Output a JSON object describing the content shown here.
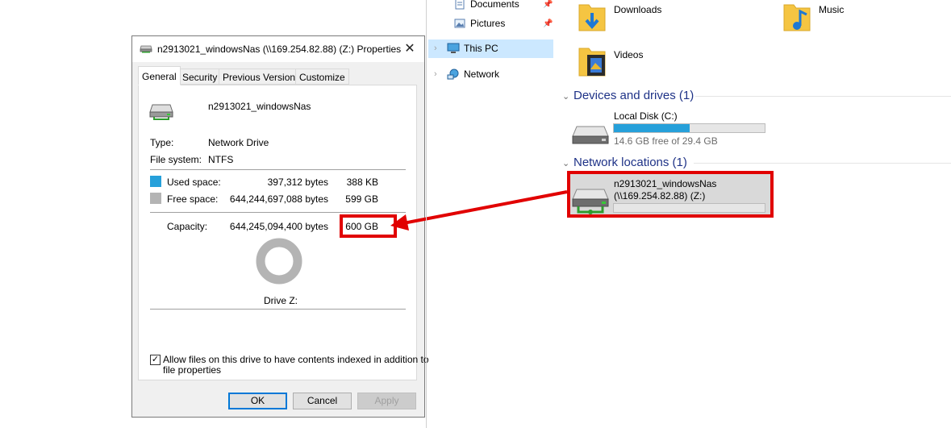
{
  "dialog": {
    "title": "n2913021_windowsNas (\\\\169.254.82.88) (Z:) Properties",
    "close_glyph": "✕",
    "tabs": [
      "General",
      "Security",
      "Previous Versions",
      "Customize"
    ],
    "active_tab": "General",
    "drive_name": "n2913021_windowsNas",
    "type_label": "Type:",
    "type_value": "Network Drive",
    "fs_label": "File system:",
    "fs_value": "NTFS",
    "used_label": "Used space:",
    "used_bytes": "397,312 bytes",
    "used_size": "388 KB",
    "free_label": "Free space:",
    "free_bytes": "644,244,697,088 bytes",
    "free_size": "599 GB",
    "capacity_label": "Capacity:",
    "capacity_bytes": "644,245,094,400 bytes",
    "capacity_size": "600 GB",
    "drive_caption": "Drive Z:",
    "used_fraction": 6e-07,
    "index_checked": true,
    "index_label_line1": "Allow files on this drive to have contents indexed in addition to",
    "index_label_line2": "file properties",
    "ok_label": "OK",
    "cancel_label": "Cancel",
    "apply_label": "Apply",
    "colors": {
      "used": "#26a0da",
      "free": "#b4b4b4",
      "highlight": "#e10000"
    }
  },
  "nav": {
    "quick_access": [
      {
        "label": "Documents",
        "icon": "documents-icon"
      },
      {
        "label": "Pictures",
        "icon": "pictures-icon"
      }
    ],
    "this_pc": "This PC",
    "network": "Network"
  },
  "content": {
    "folders": [
      {
        "label": "Downloads",
        "icon": "downloads-folder-icon"
      },
      {
        "label": "Music",
        "icon": "music-folder-icon"
      },
      {
        "label": "Videos",
        "icon": "videos-folder-icon"
      }
    ],
    "devices_header": "Devices and drives (1)",
    "local_disk": {
      "name": "Local Disk (C:)",
      "free_text": "14.6 GB free of 29.4 GB",
      "used_fraction": 0.5
    },
    "network_header": "Network locations (1)",
    "network_drive": {
      "name_line1": "n2913021_windowsNas",
      "name_line2": "(\\\\169.254.82.88) (Z:)",
      "used_fraction": 0.0
    }
  }
}
